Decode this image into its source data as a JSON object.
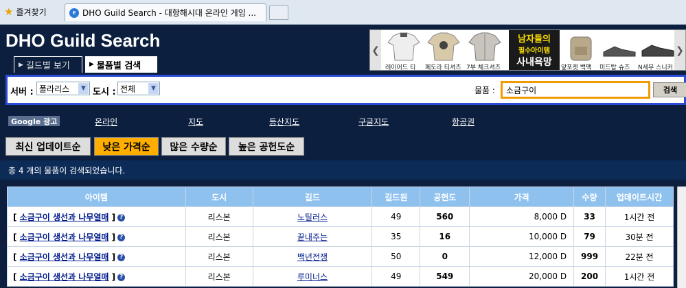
{
  "browser": {
    "favorites_label": "즐겨찾기",
    "tab_title": "DHO Guild Search - 대항해시대 온라인 게임 ..."
  },
  "header": {
    "title": "DHO Guild Search",
    "nav": {
      "guild_view": "길드별 보기",
      "item_search": "물품별 검색"
    }
  },
  "ad": {
    "captions": [
      "레이어드 티",
      "페도라 티셔츠",
      "7부 체크셔츠",
      "앞포켓 백팩",
      "미드탑 슈즈",
      "N세무 스니커"
    ],
    "center_line1": "남자들의",
    "center_line2": "필수아이템",
    "center_line3": "사내욕망"
  },
  "search": {
    "server_label": "서버 :",
    "server_value": "폴라리스",
    "city_label": "도시 :",
    "city_value": "전체",
    "item_label": "물품 :",
    "item_value": "소금구이",
    "search_button": "검색"
  },
  "links": {
    "google_ad": "Google 광고",
    "items": [
      "온라인",
      "지도",
      "등산지도",
      "구글지도",
      "항공권"
    ]
  },
  "sort_buttons": [
    "최신 업데이트순",
    "낮은 가격순",
    "많은 수량순",
    "높은 공헌도순"
  ],
  "active_sort": "낮은 가격순",
  "result_text": "총 4 개의 물품이 검색되었습니다.",
  "table": {
    "headers": [
      "아이템",
      "도시",
      "길드",
      "길드원",
      "공헌도",
      "가격",
      "수량",
      "업데이트시간"
    ],
    "rows": [
      {
        "item": "소금구이 생선과 나무열매",
        "city": "리스본",
        "guild": "노틸러스",
        "members": "49",
        "contribution": "560",
        "price": "8,000 D",
        "qty": "33",
        "updated": "1시간 전"
      },
      {
        "item": "소금구이 생선과 나무열매",
        "city": "리스본",
        "guild": "끝내주는",
        "members": "35",
        "contribution": "16",
        "price": "10,000 D",
        "qty": "79",
        "updated": "30분 전"
      },
      {
        "item": "소금구이 생선과 나무열매",
        "city": "리스본",
        "guild": "백년전쟁",
        "members": "50",
        "contribution": "0",
        "price": "12,000 D",
        "qty": "999",
        "updated": "22분 전"
      },
      {
        "item": "소금구이 생선과 나무열매",
        "city": "리스본",
        "guild": "루미너스",
        "members": "49",
        "contribution": "549",
        "price": "20,000 D",
        "qty": "200",
        "updated": "1시간 전"
      }
    ]
  },
  "colors": {
    "page_bg": "#0d1f3f",
    "table_header": "#8fc1ef",
    "active_sort": "#ffae00",
    "search_border": "#2a4bd8",
    "item_input_border": "#f29b00"
  }
}
